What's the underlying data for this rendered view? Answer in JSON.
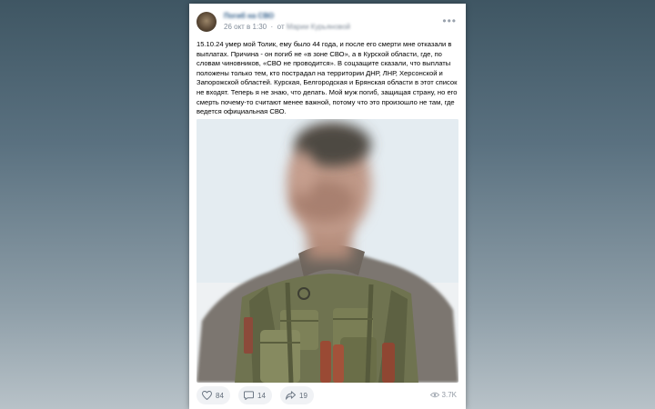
{
  "post": {
    "group_name": "Погиб на СВО",
    "date": "26 окт в 1:30",
    "author_prefix": "от",
    "author_name": "Марии Курьяновой",
    "more_icon": "ellipsis-icon",
    "text": "15.10.24 умер мой Толик, ему было 44 года, и после его смерти мне отказали в выплатах. Причина - он погиб не «в зоне СВО», а в Курской области, где, по словам чиновников, «СВО не проводится». В соцзащите сказали, что выплаты положены только тем, кто пострадал на территории ДНР, ЛНР, Херсонской и Запорожской областей. Курская, Белгородская и Брянская области в этот список не входят. Теперь я не знаю, что делать. Мой муж погиб, защищая страну, но его смерть почему-то считают менее важной, потому что это произошло не там, где ведется официальная СВО.",
    "photo_icon": "soldier-photo"
  },
  "footer": {
    "likes": "84",
    "comments": "14",
    "reposts": "19",
    "views": "3.7K",
    "like_icon": "heart-icon",
    "comment_icon": "comment-icon",
    "repost_icon": "share-icon",
    "views_icon": "eye-icon"
  },
  "colors": {
    "link": "#2a5885",
    "meta": "#818c99",
    "action_bg": "#f0f2f5"
  }
}
